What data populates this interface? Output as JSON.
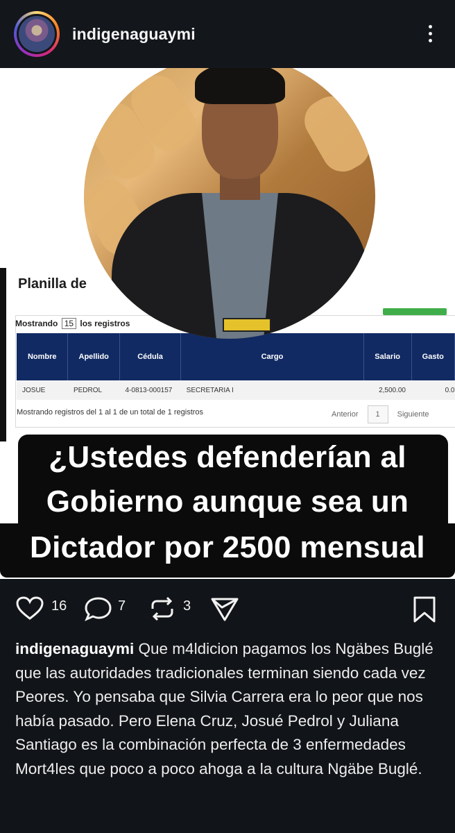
{
  "header": {
    "username": "indigenaguaymi"
  },
  "post": {
    "table_title": "Planilla de",
    "showing_prefix": "Mostrando",
    "showing_count": "15",
    "showing_suffix": "los registros",
    "columns": [
      "Nombre",
      "Apellido",
      "Cédula",
      "Cargo",
      "Salario",
      "Gasto"
    ],
    "row": [
      "JOSUE",
      "PEDROL",
      "4-0813-000157",
      "SECRETARIA I",
      "2,500.00",
      "0.0"
    ],
    "footer": "Mostrando registros del 1 al 1 de un total de 1 registros",
    "pager": {
      "prev": "Anterior",
      "page": "1",
      "next": "Siguiente"
    },
    "overlay_lines": [
      "¿Ustedes defenderían al",
      "Gobierno aunque sea un",
      "Dictador  por 2500 mensual"
    ]
  },
  "actions": {
    "likes": "16",
    "comments": "7",
    "reposts": "3",
    "icons": [
      "heart-icon",
      "comment-icon",
      "repost-icon",
      "share-icon",
      "bookmark-icon"
    ]
  },
  "caption": {
    "username": "indigenaguaymi",
    "text": " Que m4ldicion pagamos los Ngäbes Buglé que las autoridades tradicionales terminan siendo cada vez  Peores. Yo pensaba que Silvia Carrera era lo peor que nos había pasado. Pero Elena Cruz, Josué Pedrol y Juliana Santiago es la combinación perfecta  de 3  enfermedades Mort4les que poco a poco ahoga a la cultura Ngäbe Buglé."
  },
  "colors": {
    "background": "#111418",
    "table_header": "#112a63",
    "overlay": "#0b0b0b"
  }
}
